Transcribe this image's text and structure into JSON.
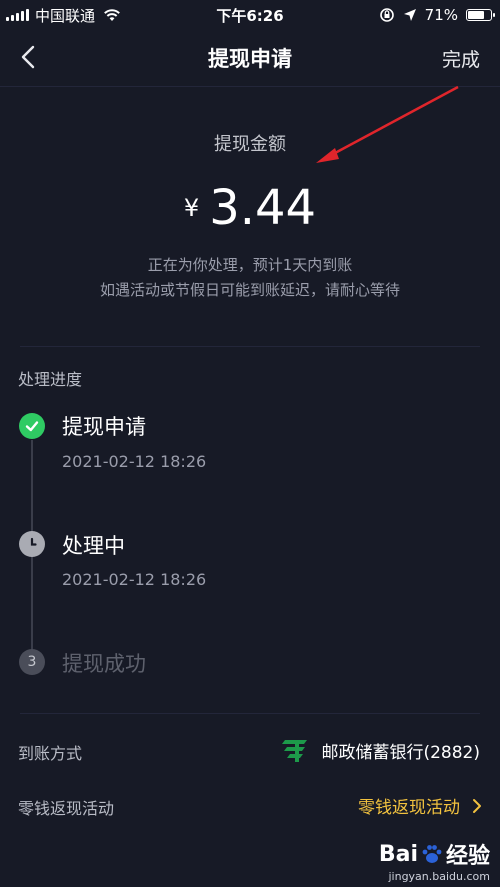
{
  "status_bar": {
    "carrier": "中国联通",
    "time": "下午6:26",
    "battery": "71%",
    "battery_level": 0.71
  },
  "nav": {
    "title": "提现申请",
    "done_label": "完成"
  },
  "amount": {
    "label": "提现金额",
    "currency": "¥",
    "value": "3.44",
    "notice_line1": "正在为你处理，预计1天内到账",
    "notice_line2": "如遇活动或节假日可能到账延迟，请耐心等待"
  },
  "progress": {
    "title": "处理进度",
    "steps": [
      {
        "title": "提现申请",
        "time": "2021-02-12 18:26",
        "status": "done"
      },
      {
        "title": "处理中",
        "time": "2021-02-12 18:26",
        "status": "processing"
      },
      {
        "title": "提现成功",
        "number": "3",
        "status": "pending"
      }
    ]
  },
  "details": {
    "arrival_label": "到账方式",
    "bank_name": "邮政储蓄银行(2882)",
    "activity_label": "零钱返现活动",
    "activity_link": "零钱返现活动"
  },
  "watermark": {
    "brand_left": "Bai",
    "brand_right": "经验",
    "url": "jingyan.baidu.com"
  },
  "icons": {
    "back": "chevron-left-icon",
    "check": "check-icon",
    "clock": "clock-icon",
    "chevron": "chevron-right-icon"
  },
  "colors": {
    "background": "#171a26",
    "success": "#2fcb63",
    "link": "#f2c23f",
    "arrow": "#e0252b",
    "bank_green": "#1d9a4a"
  }
}
